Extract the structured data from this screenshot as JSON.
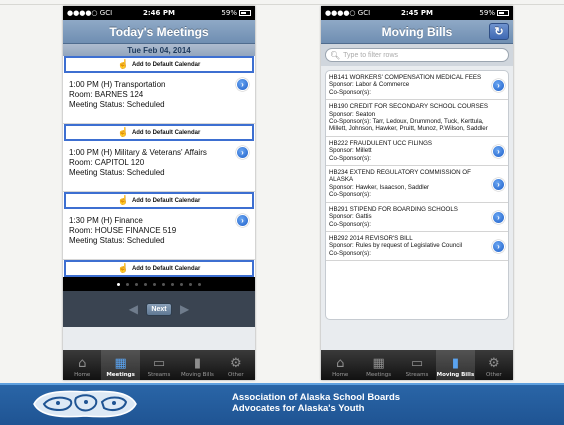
{
  "phone_left": {
    "status": {
      "carrier": "●●●●○ GCI",
      "time": "2:46 PM",
      "battery": "59%"
    },
    "title": "Today's Meetings",
    "date": "Tue Feb 04, 2014",
    "add_calendar_label": "Add to Default Calendar",
    "meetings": [
      {
        "line1": "1:00 PM (H)  Transportation",
        "line2": "Room:  BARNES 124",
        "line3": "Meeting Status: Scheduled"
      },
      {
        "line1": "1:00 PM (H)  Military & Veterans' Affairs",
        "line2": "Room:  CAPITOL 120",
        "line3": "Meeting Status: Scheduled"
      },
      {
        "line1": "1:30 PM (H)  Finance",
        "line2": "Room:  HOUSE FINANCE 519",
        "line3": "Meeting Status: Scheduled"
      }
    ],
    "page_count": 10,
    "active_page": 0,
    "next_label": "Next"
  },
  "phone_right": {
    "status": {
      "carrier": "●●●●○ GCI",
      "time": "2:45 PM",
      "battery": "59%"
    },
    "title": "Moving Bills",
    "search_placeholder": "Type to filter rows",
    "bills": [
      {
        "title": "HB141 WORKERS' COMPENSATION MEDICAL FEES",
        "sponsor": "Sponsor: Labor & Commerce",
        "cosponsor": "Co-Sponsor(s):"
      },
      {
        "title": "HB190 CREDIT FOR SECONDARY SCHOOL COURSES",
        "sponsor": "Sponsor: Seaton",
        "cosponsor": "Co-Sponsor(s): Tarr, Ledoux, Drummond, Tuck, Kerttula, Millett, Johnson, Hawker, Pruitt, Munoz, P.Wilson, Saddler"
      },
      {
        "title": "HB222 FRAUDULENT UCC FILINGS",
        "sponsor": "Sponsor: Millett",
        "cosponsor": "Co-Sponsor(s):"
      },
      {
        "title": "HB234 EXTEND REGULATORY COMMISSION OF ALASKA",
        "sponsor": "Sponsor: Hawker, Isaacson, Saddler",
        "cosponsor": "Co-Sponsor(s):"
      },
      {
        "title": "HB291 STIPEND FOR BOARDING SCHOOLS",
        "sponsor": "Sponsor: Gattis",
        "cosponsor": "Co-Sponsor(s):"
      },
      {
        "title": "HB292 2014 REVISOR'S BILL",
        "sponsor": "Sponsor: Rules by request of Legislative Council",
        "cosponsor": "Co-Sponsor(s):"
      }
    ]
  },
  "tabs": [
    {
      "label": "Home",
      "icon": "home-icon"
    },
    {
      "label": "Meetings",
      "icon": "calendar-icon"
    },
    {
      "label": "Streams",
      "icon": "monitor-icon"
    },
    {
      "label": "Moving Bills",
      "icon": "document-icon"
    },
    {
      "label": "Other",
      "icon": "gear-icon"
    }
  ],
  "footer": {
    "line1": "Association of Alaska School Boards",
    "line2": "Advocates for Alaska's Youth"
  }
}
